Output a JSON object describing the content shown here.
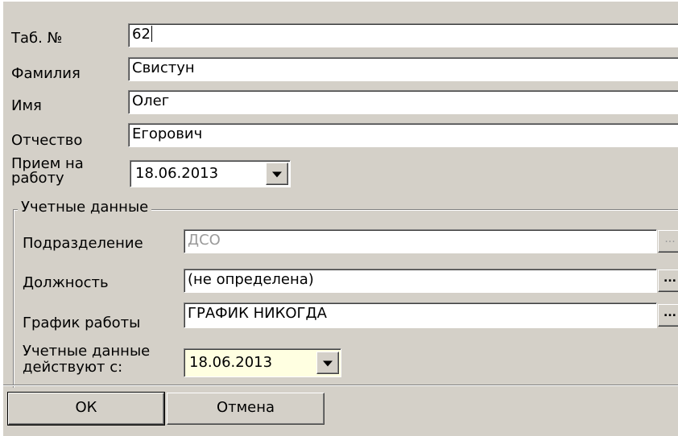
{
  "form": {
    "tab_no_label": "Таб. №",
    "tab_no_value": "62",
    "lastname_label": "Фамилия",
    "lastname_value": "Свистун",
    "firstname_label": "Имя",
    "firstname_value": "Олег",
    "patronymic_label": "Отчество",
    "patronymic_value": "Егорович",
    "hire_label": "Прием на работу",
    "hire_value": "18.06.2013"
  },
  "account": {
    "group_title": "Учетные данные",
    "department_label": "Подразделение",
    "department_value": "ДСО",
    "position_label": "Должность",
    "position_value": "(не определена)",
    "schedule_label": "График работы",
    "schedule_value": "ГРАФИК НИКОГДА",
    "valid_from_label": "Учетные данные действуют с:",
    "valid_from_value": "18.06.2013",
    "ellipsis": "..."
  },
  "buttons": {
    "ok": "ОК",
    "cancel": "Отмена"
  },
  "icons": {
    "dropdown": "dropdown-arrow-icon",
    "ellipsis": "ellipsis-icon"
  },
  "colors": {
    "face": "#d4d0c8",
    "field": "#ffffff",
    "highlight_field": "#ffffe1",
    "disabled_text": "#9a9a9a"
  }
}
